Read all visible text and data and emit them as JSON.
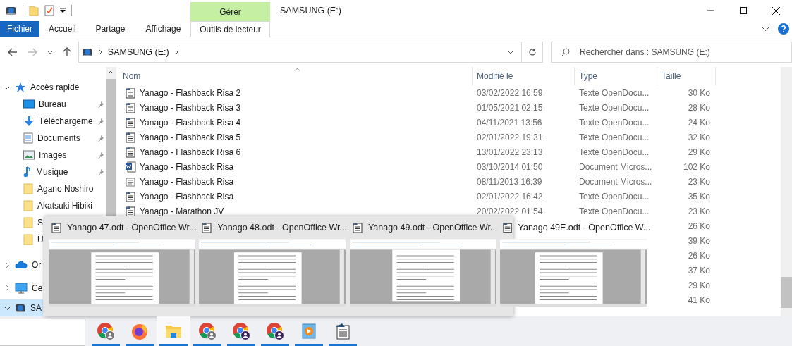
{
  "window": {
    "title": "SAMSUNG (E:)"
  },
  "ribbon": {
    "context_group": "Gérer",
    "tabs": [
      {
        "label": "Fichier",
        "kind": "file"
      },
      {
        "label": "Accueil",
        "kind": "plain"
      },
      {
        "label": "Partage",
        "kind": "plain"
      },
      {
        "label": "Affichage",
        "kind": "plain"
      },
      {
        "label": "Outils de lecteur",
        "kind": "context"
      }
    ]
  },
  "address": {
    "path": "SAMSUNG (E:)",
    "search_placeholder": "Rechercher dans : SAMSUNG (E:)"
  },
  "sidebar": {
    "items": [
      {
        "label": "Accès rapide",
        "kind": "star",
        "expanded": true,
        "selected": false
      },
      {
        "label": "Bureau",
        "kind": "desktop",
        "pinned": true,
        "selected": false
      },
      {
        "label": "Téléchargeme",
        "kind": "download",
        "pinned": true,
        "selected": false
      },
      {
        "label": "Documents",
        "kind": "documents",
        "pinned": true,
        "selected": false
      },
      {
        "label": "Images",
        "kind": "images",
        "pinned": true,
        "selected": false
      },
      {
        "label": "Musique",
        "kind": "music",
        "pinned": true,
        "selected": false
      },
      {
        "label": "Agano Noshiro",
        "kind": "folder",
        "pinned": false,
        "selected": false
      },
      {
        "label": "Akatsuki Hibiki",
        "kind": "folder",
        "pinned": false,
        "selected": false
      },
      {
        "label": "S",
        "kind": "folder",
        "pinned": false,
        "selected": false
      },
      {
        "label": "U",
        "kind": "folder",
        "pinned": false,
        "selected": false
      },
      {
        "label": "Or",
        "kind": "cloud",
        "expanded": false,
        "selected": false
      },
      {
        "label": "Ce",
        "kind": "pc",
        "expanded": false,
        "selected": false
      },
      {
        "label": "SA",
        "kind": "drive",
        "expanded": true,
        "selected": true
      }
    ]
  },
  "files": {
    "columns": [
      "Nom",
      "Modifié le",
      "Type",
      "Taille"
    ],
    "rows": [
      {
        "kind": "odt",
        "name": "Yanago - Flashback Risa 2",
        "modified": "03/02/2022 16:59",
        "type": "Texte OpenDocu...",
        "size": "30 Ko"
      },
      {
        "kind": "odt",
        "name": "Yanago - Flashback Risa 3",
        "modified": "01/05/2021 02:15",
        "type": "Texte OpenDocu...",
        "size": "28 Ko"
      },
      {
        "kind": "odt",
        "name": "Yanago - Flashback Risa 4",
        "modified": "04/11/2021 13:56",
        "type": "Texte OpenDocu...",
        "size": "24 Ko"
      },
      {
        "kind": "odt",
        "name": "Yanago - Flashback Risa 5",
        "modified": "02/01/2022 19:31",
        "type": "Texte OpenDocu...",
        "size": "32 Ko"
      },
      {
        "kind": "odt",
        "name": "Yanago - Flashback Risa 6",
        "modified": "13/01/2022 23:13",
        "type": "Texte OpenDocu...",
        "size": "29 Ko"
      },
      {
        "kind": "word",
        "name": "Yanago - Flashback Risa",
        "modified": "03/10/2014 01:50",
        "type": "Document Micros...",
        "size": "102 Ko"
      },
      {
        "kind": "doc",
        "name": "Yanago - Flashback Risa",
        "modified": "08/11/2013 16:39",
        "type": "Document Micros...",
        "size": "23 Ko"
      },
      {
        "kind": "odt",
        "name": "Yanago - Flashback Risa",
        "modified": "02/01/2022 16:42",
        "type": "Texte OpenDocu...",
        "size": "35 Ko"
      },
      {
        "kind": "odt",
        "name": "Yanago - Marathon JV",
        "modified": "20/02/2022 01:54",
        "type": "Texte OpenDocu...",
        "size": "23 Ko"
      },
      {
        "kind": "hidden",
        "size": "26 Ko"
      },
      {
        "kind": "hidden",
        "size": "39 Ko"
      },
      {
        "kind": "hidden",
        "size": "26 Ko"
      },
      {
        "kind": "hidden",
        "size": "37 Ko"
      },
      {
        "kind": "hidden",
        "size": "29 Ko"
      },
      {
        "kind": "hidden",
        "size": "41 Ko"
      }
    ]
  },
  "thumbnails": [
    {
      "title": "Yanago 47.odt - OpenOffice Wr..."
    },
    {
      "title": "Yanago 48.odt - OpenOffice Wr..."
    },
    {
      "title": "Yanago 49.odt - OpenOffice Wr..."
    },
    {
      "title": "Yanago 49E.odt - OpenOffice W..."
    }
  ],
  "taskbar": {
    "apps": [
      {
        "kind": "chrome-grey",
        "selected": false
      },
      {
        "kind": "firefox",
        "selected": false
      },
      {
        "kind": "explorer",
        "selected": true
      },
      {
        "kind": "chrome-grey",
        "selected": false
      },
      {
        "kind": "chrome-purple",
        "selected": false
      },
      {
        "kind": "chrome-purple",
        "selected": false
      },
      {
        "kind": "player",
        "selected": false
      },
      {
        "kind": "writer",
        "selected": false
      }
    ]
  }
}
